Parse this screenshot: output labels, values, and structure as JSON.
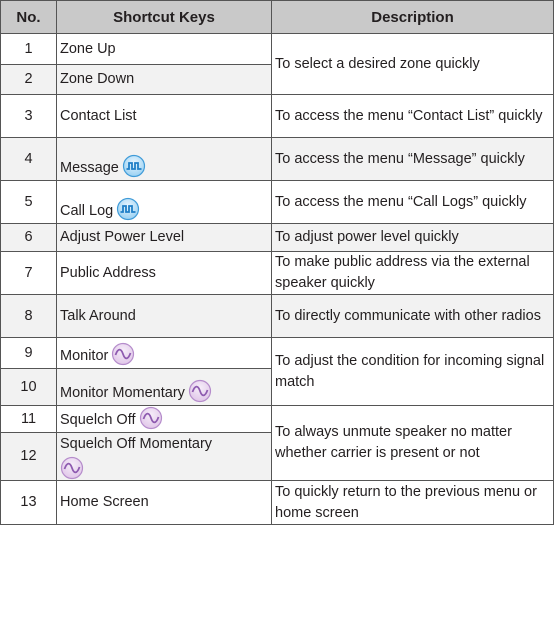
{
  "headers": {
    "no": "No.",
    "keys": "Shortcut Keys",
    "description": "Description"
  },
  "rows": [
    {
      "no": "1",
      "key": "Zone Up"
    },
    {
      "no": "2",
      "key": "Zone Down"
    },
    {
      "no": "3",
      "key": "Contact List"
    },
    {
      "no": "4",
      "key": "Message",
      "icon": "digital-mode-icon"
    },
    {
      "no": "5",
      "key": "Call Log",
      "icon": "digital-mode-icon"
    },
    {
      "no": "6",
      "key": "Adjust Power Level"
    },
    {
      "no": "7",
      "key": "Public Address"
    },
    {
      "no": "8",
      "key": "Talk Around"
    },
    {
      "no": "9",
      "key": "Monitor",
      "icon": "analog-mode-icon"
    },
    {
      "no": "10",
      "key": "Monitor Momentary",
      "icon": "analog-mode-icon"
    },
    {
      "no": "11",
      "key": "Squelch Off",
      "icon": "analog-mode-icon"
    },
    {
      "no": "12",
      "key": "Squelch Off Momentary",
      "icon": "analog-mode-icon"
    },
    {
      "no": "13",
      "key": "Home Screen"
    }
  ],
  "descriptions": {
    "zone": "To select a desired zone quickly",
    "contact_list": "To access the menu “Contact List” quickly",
    "message": "To access the menu “Message” quickly",
    "call_log": "To access the menu “Call Logs” quickly",
    "power": "To adjust power level quickly",
    "public_address": "To make public address via the external speaker quickly",
    "talk_around": "To directly communicate with other radios",
    "monitor": "To adjust the condition for incoming signal match",
    "squelch": "To always unmute speaker no matter whether carrier is present or not",
    "home": "To quickly return to the previous menu or home screen"
  },
  "colors": {
    "header_bg": "#c9c9c9",
    "alt_row_bg": "#f2f2f2",
    "digital_icon": "#4aa3df",
    "analog_icon": "#c79ad8"
  }
}
